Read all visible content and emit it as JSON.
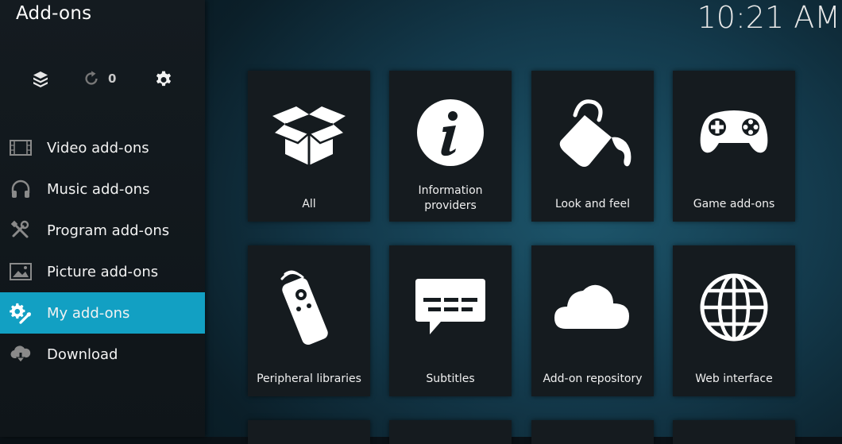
{
  "header": {
    "title": "Add-ons",
    "clock": "10:21 AM"
  },
  "quick_actions": {
    "update_count": "0"
  },
  "sidebar": {
    "items": [
      {
        "label": "Video add-ons",
        "icon": "film-icon",
        "active": false
      },
      {
        "label": "Music add-ons",
        "icon": "headphones-icon",
        "active": false
      },
      {
        "label": "Program add-ons",
        "icon": "tools-icon",
        "active": false
      },
      {
        "label": "Picture add-ons",
        "icon": "picture-icon",
        "active": false
      },
      {
        "label": "My add-ons",
        "icon": "gears-icon",
        "active": true
      },
      {
        "label": "Download",
        "icon": "cloud-download-icon",
        "active": false
      }
    ]
  },
  "tiles": [
    {
      "label": "All",
      "icon": "open-box-icon"
    },
    {
      "label": "Information providers",
      "icon": "info-icon"
    },
    {
      "label": "Look and feel",
      "icon": "paint-bucket-icon"
    },
    {
      "label": "Game add-ons",
      "icon": "gamepad-icon"
    },
    {
      "label": "Peripheral libraries",
      "icon": "remote-control-icon"
    },
    {
      "label": "Subtitles",
      "icon": "subtitles-icon"
    },
    {
      "label": "Add-on repository",
      "icon": "cloud-icon"
    },
    {
      "label": "Web interface",
      "icon": "globe-icon"
    }
  ],
  "colors": {
    "accent": "#12a0c3",
    "tile_bg": "#151b1f",
    "sidebar_bg": "#141b20"
  }
}
